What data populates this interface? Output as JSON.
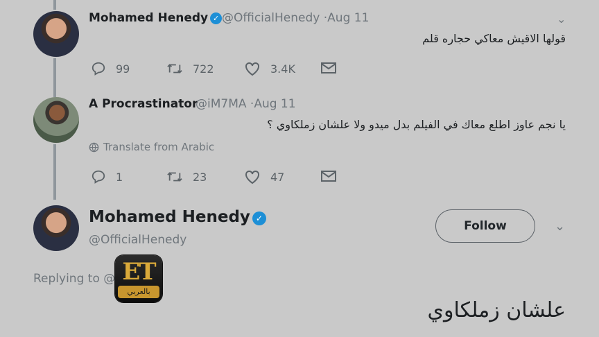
{
  "tweets": [
    {
      "name": "Mohamed Henedy",
      "handle": "@OfficialHenedy",
      "date": "·Aug 11",
      "verified": true,
      "text": "قولها الاقيش معاكي حجاره قلم",
      "replies": "99",
      "retweets": "722",
      "likes": "3.4K"
    },
    {
      "name": "A Procrastinator",
      "handle": "@iM7MA",
      "date": "·Aug 11",
      "verified": false,
      "text": "يا نجم عاوز اطلع معاك في الفيلم بدل ميدو ولا علشان زملكاوي ؟",
      "translate": "Translate from Arabic",
      "replies": "1",
      "retweets": "23",
      "likes": "47"
    }
  ],
  "focus": {
    "name": "Mohamed Henedy",
    "handle": "@OfficialHenedy",
    "follow_label": "Follow",
    "replying_to": "Replying to @",
    "text": "علشان زملكاوي"
  },
  "watermark": {
    "et": "ET",
    "band": "بالعربي"
  },
  "icons": {
    "verified": "verified-badge-icon",
    "reply": "reply-icon",
    "retweet": "retweet-icon",
    "like": "heart-icon",
    "dm": "envelope-icon",
    "caret": "chevron-down-icon",
    "globe": "globe-icon"
  },
  "colors": {
    "background": "#c9c9c9",
    "verified": "#1d8fd6",
    "et_gold": "#d9a93a"
  }
}
